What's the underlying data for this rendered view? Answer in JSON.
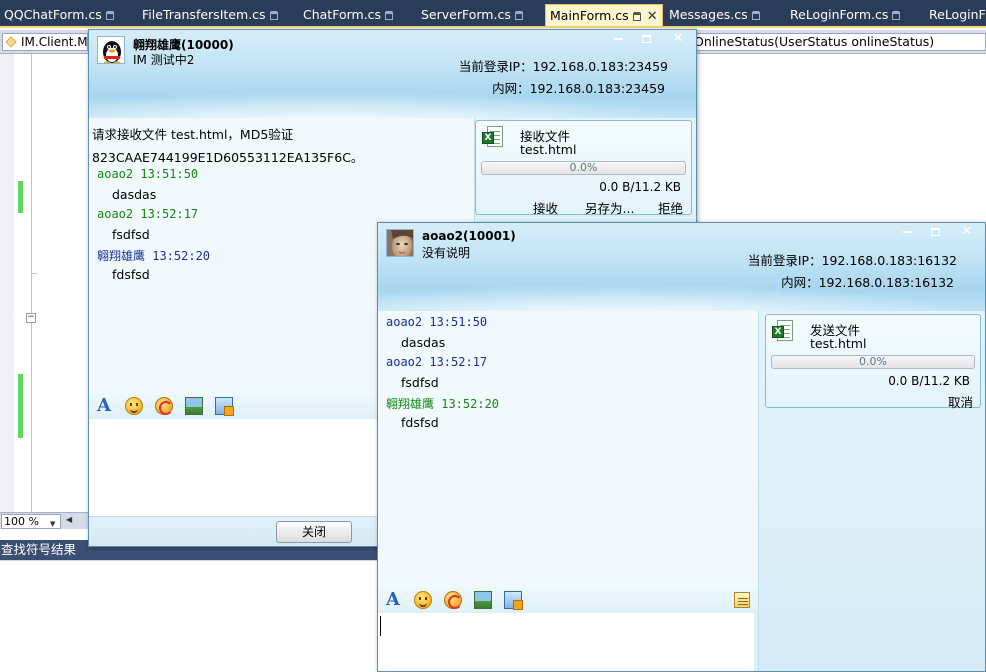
{
  "ide": {
    "tabs": [
      {
        "label": "QQChatForm.cs"
      },
      {
        "label": "FileTransfersItem.cs"
      },
      {
        "label": "ChatForm.cs"
      },
      {
        "label": "ServerForm.cs"
      },
      {
        "label": "MainForm.cs"
      },
      {
        "label": "Messages.cs"
      },
      {
        "label": "ReLoginForm.cs"
      },
      {
        "label": "ReLoginFo"
      }
    ],
    "tab_close_glyph": "✕",
    "nav_class": "IM.Client.M",
    "nav_member": "OnlineStatus(UserStatus onlineStatus)",
    "zoom": "100 %",
    "find_results_title": "查找符号结果"
  },
  "window1": {
    "user": "翱翔雄鹰(10000)",
    "signature": "IM 测试中2",
    "login_ip": "当前登录IP：192.168.0.183:23459",
    "lan_ip": "内网：192.168.0.183:23459",
    "messages": [
      {
        "text": "请求接收文件 test.html，MD5验证"
      },
      {
        "text": "823CAAE744199E1D60553112EA135F6C。"
      },
      {
        "header": "aoao2 13:51:50",
        "body": "dasdas"
      },
      {
        "header": "aoao2 13:52:17",
        "body": "fsdfsd"
      },
      {
        "header": "翱翔雄鹰 13:52:20",
        "body": "fdsfsd"
      }
    ],
    "file": {
      "title": "接收文件",
      "name": "test.html",
      "progress_text": "0.0%",
      "progress": 0.0,
      "size": "0.0 B/11.2 KB",
      "actions": [
        "接收",
        "另存为...",
        "拒绝"
      ]
    },
    "close_button": "关闭"
  },
  "window2": {
    "user": "aoao2(10001)",
    "signature": "没有说明",
    "login_ip": "当前登录IP：192.168.0.183:16132",
    "lan_ip": "内网：192.168.0.183:16132",
    "messages": [
      {
        "header": "aoao2 13:51:50",
        "body": "dasdas"
      },
      {
        "header": "aoao2 13:52:17",
        "body": "fsdfsd"
      },
      {
        "header": "翱翔雄鹰 13:52:20",
        "body": "fdsfsd"
      }
    ],
    "file": {
      "title": "发送文件",
      "name": "test.html",
      "progress_text": "0.0%",
      "progress": 0.0,
      "size": "0.0 B/11.2 KB",
      "actions": [
        "取消"
      ]
    }
  },
  "colors": {
    "self_name": "#1a2f9c",
    "peer_name": "#118811",
    "ide_tabbar": "#2b3c59",
    "window_border": "#5f8fb0"
  },
  "icons": {
    "toolbar": [
      "font-icon",
      "emoticon-icon",
      "shake-icon",
      "picture-icon",
      "screenshot-icon"
    ],
    "history": "message-history-icon",
    "file_type": "excel-file-icon"
  }
}
